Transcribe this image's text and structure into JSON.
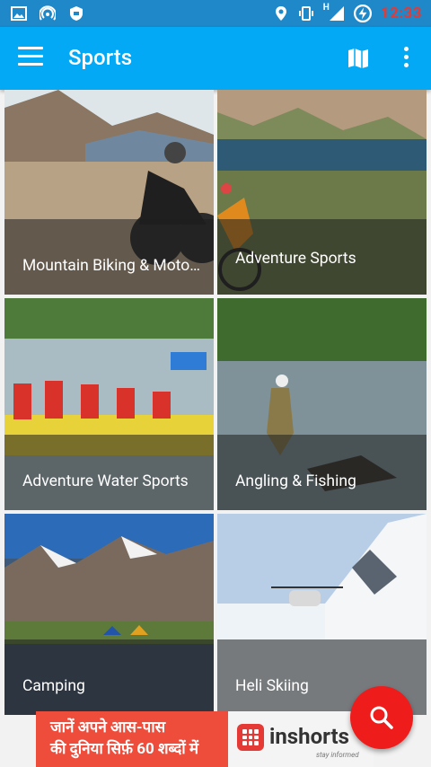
{
  "status_bar": {
    "time": "12:33",
    "network_label": "H",
    "icons": [
      "image-icon",
      "hotspot-icon",
      "shield-icon",
      "location-icon",
      "vibrate-icon",
      "signal-icon",
      "battery-charging-icon"
    ]
  },
  "app_bar": {
    "title": "Sports",
    "actions": [
      "menu-icon",
      "map-icon",
      "more-vert-icon"
    ]
  },
  "categories": [
    {
      "label": "Mountain Biking & Motorbiking"
    },
    {
      "label": "Adventure Sports"
    },
    {
      "label": "Adventure Water Sports"
    },
    {
      "label": "Angling & Fishing"
    },
    {
      "label": "Camping"
    },
    {
      "label": "Heli Skiing"
    }
  ],
  "ad_banner": {
    "hindi_line1": "जानें अपने आस-पास",
    "hindi_line2": "की दुनिया सिर्फ़ 60 शब्दों में",
    "brand": "inshorts",
    "tagline": "stay informed"
  },
  "fab": {
    "icon": "search-icon"
  },
  "colors": {
    "app_bar": "#03a9f4",
    "status_bar": "#1e88c9",
    "fab": "#ef1c1c",
    "clock": "#e53935"
  }
}
